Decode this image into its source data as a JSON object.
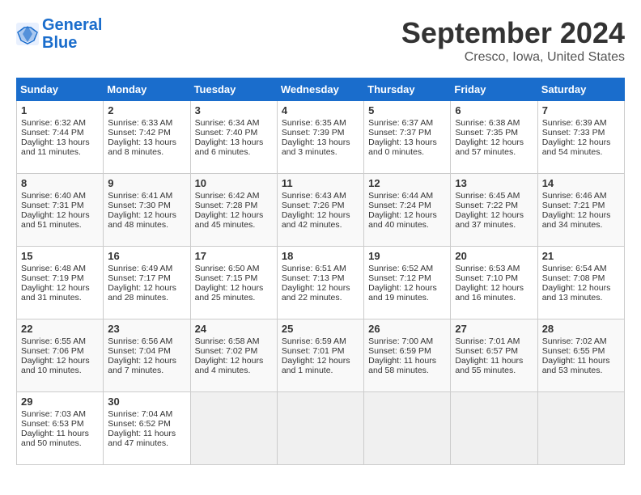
{
  "header": {
    "logo_line1": "General",
    "logo_line2": "Blue",
    "month": "September 2024",
    "location": "Cresco, Iowa, United States"
  },
  "columns": [
    "Sunday",
    "Monday",
    "Tuesday",
    "Wednesday",
    "Thursday",
    "Friday",
    "Saturday"
  ],
  "weeks": [
    [
      {
        "num": "1",
        "lines": [
          "Sunrise: 6:32 AM",
          "Sunset: 7:44 PM",
          "Daylight: 13 hours",
          "and 11 minutes."
        ]
      },
      {
        "num": "2",
        "lines": [
          "Sunrise: 6:33 AM",
          "Sunset: 7:42 PM",
          "Daylight: 13 hours",
          "and 8 minutes."
        ]
      },
      {
        "num": "3",
        "lines": [
          "Sunrise: 6:34 AM",
          "Sunset: 7:40 PM",
          "Daylight: 13 hours",
          "and 6 minutes."
        ]
      },
      {
        "num": "4",
        "lines": [
          "Sunrise: 6:35 AM",
          "Sunset: 7:39 PM",
          "Daylight: 13 hours",
          "and 3 minutes."
        ]
      },
      {
        "num": "5",
        "lines": [
          "Sunrise: 6:37 AM",
          "Sunset: 7:37 PM",
          "Daylight: 13 hours",
          "and 0 minutes."
        ]
      },
      {
        "num": "6",
        "lines": [
          "Sunrise: 6:38 AM",
          "Sunset: 7:35 PM",
          "Daylight: 12 hours",
          "and 57 minutes."
        ]
      },
      {
        "num": "7",
        "lines": [
          "Sunrise: 6:39 AM",
          "Sunset: 7:33 PM",
          "Daylight: 12 hours",
          "and 54 minutes."
        ]
      }
    ],
    [
      {
        "num": "8",
        "lines": [
          "Sunrise: 6:40 AM",
          "Sunset: 7:31 PM",
          "Daylight: 12 hours",
          "and 51 minutes."
        ]
      },
      {
        "num": "9",
        "lines": [
          "Sunrise: 6:41 AM",
          "Sunset: 7:30 PM",
          "Daylight: 12 hours",
          "and 48 minutes."
        ]
      },
      {
        "num": "10",
        "lines": [
          "Sunrise: 6:42 AM",
          "Sunset: 7:28 PM",
          "Daylight: 12 hours",
          "and 45 minutes."
        ]
      },
      {
        "num": "11",
        "lines": [
          "Sunrise: 6:43 AM",
          "Sunset: 7:26 PM",
          "Daylight: 12 hours",
          "and 42 minutes."
        ]
      },
      {
        "num": "12",
        "lines": [
          "Sunrise: 6:44 AM",
          "Sunset: 7:24 PM",
          "Daylight: 12 hours",
          "and 40 minutes."
        ]
      },
      {
        "num": "13",
        "lines": [
          "Sunrise: 6:45 AM",
          "Sunset: 7:22 PM",
          "Daylight: 12 hours",
          "and 37 minutes."
        ]
      },
      {
        "num": "14",
        "lines": [
          "Sunrise: 6:46 AM",
          "Sunset: 7:21 PM",
          "Daylight: 12 hours",
          "and 34 minutes."
        ]
      }
    ],
    [
      {
        "num": "15",
        "lines": [
          "Sunrise: 6:48 AM",
          "Sunset: 7:19 PM",
          "Daylight: 12 hours",
          "and 31 minutes."
        ]
      },
      {
        "num": "16",
        "lines": [
          "Sunrise: 6:49 AM",
          "Sunset: 7:17 PM",
          "Daylight: 12 hours",
          "and 28 minutes."
        ]
      },
      {
        "num": "17",
        "lines": [
          "Sunrise: 6:50 AM",
          "Sunset: 7:15 PM",
          "Daylight: 12 hours",
          "and 25 minutes."
        ]
      },
      {
        "num": "18",
        "lines": [
          "Sunrise: 6:51 AM",
          "Sunset: 7:13 PM",
          "Daylight: 12 hours",
          "and 22 minutes."
        ]
      },
      {
        "num": "19",
        "lines": [
          "Sunrise: 6:52 AM",
          "Sunset: 7:12 PM",
          "Daylight: 12 hours",
          "and 19 minutes."
        ]
      },
      {
        "num": "20",
        "lines": [
          "Sunrise: 6:53 AM",
          "Sunset: 7:10 PM",
          "Daylight: 12 hours",
          "and 16 minutes."
        ]
      },
      {
        "num": "21",
        "lines": [
          "Sunrise: 6:54 AM",
          "Sunset: 7:08 PM",
          "Daylight: 12 hours",
          "and 13 minutes."
        ]
      }
    ],
    [
      {
        "num": "22",
        "lines": [
          "Sunrise: 6:55 AM",
          "Sunset: 7:06 PM",
          "Daylight: 12 hours",
          "and 10 minutes."
        ]
      },
      {
        "num": "23",
        "lines": [
          "Sunrise: 6:56 AM",
          "Sunset: 7:04 PM",
          "Daylight: 12 hours",
          "and 7 minutes."
        ]
      },
      {
        "num": "24",
        "lines": [
          "Sunrise: 6:58 AM",
          "Sunset: 7:02 PM",
          "Daylight: 12 hours",
          "and 4 minutes."
        ]
      },
      {
        "num": "25",
        "lines": [
          "Sunrise: 6:59 AM",
          "Sunset: 7:01 PM",
          "Daylight: 12 hours",
          "and 1 minute."
        ]
      },
      {
        "num": "26",
        "lines": [
          "Sunrise: 7:00 AM",
          "Sunset: 6:59 PM",
          "Daylight: 11 hours",
          "and 58 minutes."
        ]
      },
      {
        "num": "27",
        "lines": [
          "Sunrise: 7:01 AM",
          "Sunset: 6:57 PM",
          "Daylight: 11 hours",
          "and 55 minutes."
        ]
      },
      {
        "num": "28",
        "lines": [
          "Sunrise: 7:02 AM",
          "Sunset: 6:55 PM",
          "Daylight: 11 hours",
          "and 53 minutes."
        ]
      }
    ],
    [
      {
        "num": "29",
        "lines": [
          "Sunrise: 7:03 AM",
          "Sunset: 6:53 PM",
          "Daylight: 11 hours",
          "and 50 minutes."
        ]
      },
      {
        "num": "30",
        "lines": [
          "Sunrise: 7:04 AM",
          "Sunset: 6:52 PM",
          "Daylight: 11 hours",
          "and 47 minutes."
        ]
      },
      {
        "num": "",
        "lines": []
      },
      {
        "num": "",
        "lines": []
      },
      {
        "num": "",
        "lines": []
      },
      {
        "num": "",
        "lines": []
      },
      {
        "num": "",
        "lines": []
      }
    ]
  ]
}
